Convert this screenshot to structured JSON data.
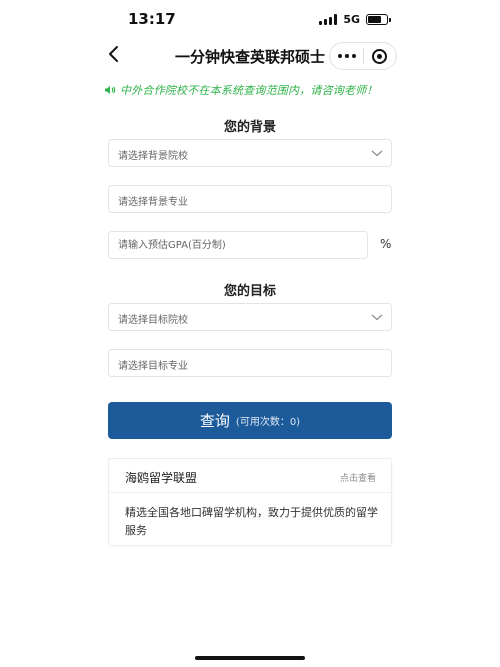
{
  "status_bar": {
    "time": "13:17",
    "network": "5G"
  },
  "nav": {
    "title": "一分钟快查英联邦硕士"
  },
  "notice": {
    "text": "中外合作院校不在本系统查询范围内，请咨询老师！",
    "color": "#2fb34a"
  },
  "background": {
    "title": "您的背景",
    "school_placeholder": "请选择背景院校",
    "major_placeholder": "请选择背景专业",
    "gpa_placeholder": "请输入预估GPA(百分制)",
    "gpa_unit": "%"
  },
  "target": {
    "title": "您的目标",
    "school_placeholder": "请选择目标院校",
    "major_placeholder": "请选择目标专业"
  },
  "query": {
    "label": "查询",
    "count_text": "(可用次数：0)",
    "color": "#1c5a9a"
  },
  "card": {
    "title": "海鸥留学联盟",
    "link": "点击查看",
    "description": "精选全国各地口碑留学机构，致力于提供优质的留学服务"
  }
}
